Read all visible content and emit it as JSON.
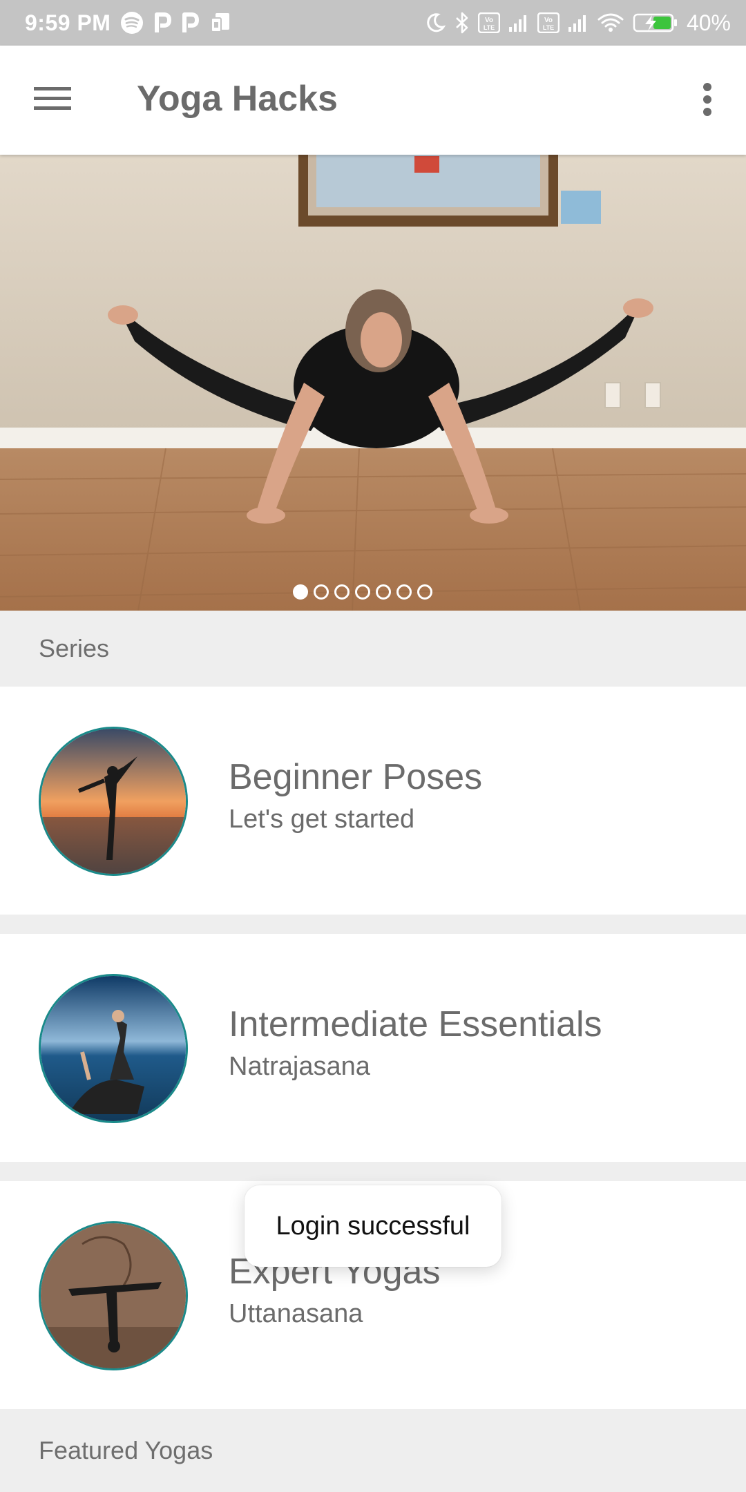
{
  "status_bar": {
    "time": "9:59 PM",
    "battery": "40%",
    "left_icons": [
      "spotify-icon",
      "p-app-icon",
      "p-app-icon",
      "sim-card-icon"
    ],
    "right_icons": [
      "moon-icon",
      "bluetooth-icon",
      "volte-icon",
      "signal-icon",
      "volte-icon",
      "signal-icon",
      "wifi-icon",
      "battery-charging-icon"
    ],
    "volte_label": "Vo LTE"
  },
  "app_bar": {
    "title": "Yoga Hacks",
    "menu_icon": "hamburger-menu-icon",
    "overflow_icon": "more-vert-icon"
  },
  "carousel": {
    "slide_count": 7,
    "active_index": 0
  },
  "sections": {
    "series": "Series",
    "featured": "Featured Yogas"
  },
  "series": [
    {
      "title": "Beginner Poses",
      "subtitle": "Let's get started"
    },
    {
      "title": "Intermediate Essentials",
      "subtitle": "Natrajasana"
    },
    {
      "title": "Expert Yogas",
      "subtitle": "Uttanasana"
    }
  ],
  "toast": {
    "message": "Login successful"
  },
  "colors": {
    "status_bar": "#c4c4c4",
    "app_bar": "#ffffff",
    "title_text": "#6b6b6b",
    "section_header_bg": "#eeeeee",
    "thumb_border": "#1a8a8a"
  }
}
